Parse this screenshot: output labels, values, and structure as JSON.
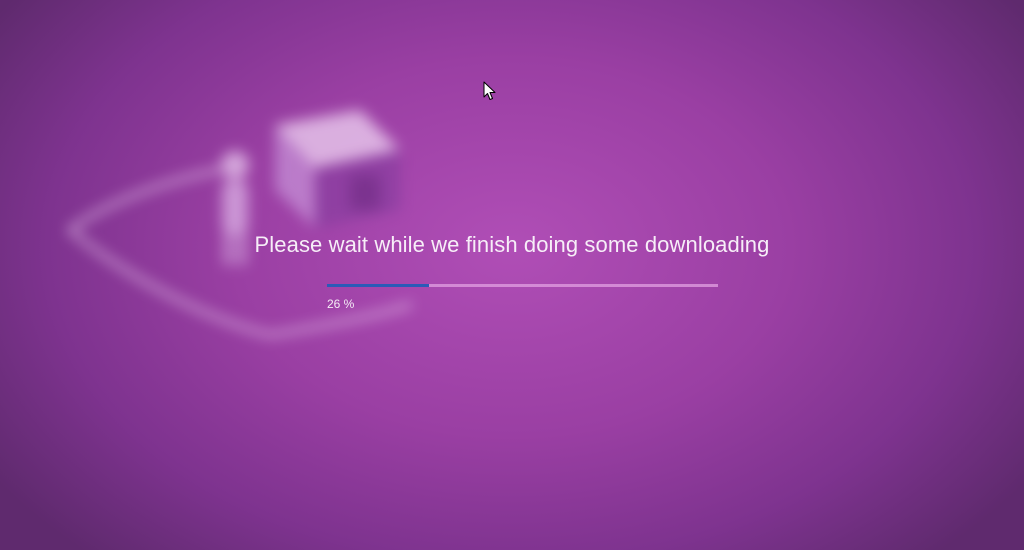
{
  "setup": {
    "message": "Please wait while we finish doing some downloading",
    "progress": {
      "value": 0.26,
      "label": "26 %"
    }
  },
  "colors": {
    "background": "#a645ad",
    "progress_fill": "#2a5bb8",
    "progress_track": "#e2a0e2",
    "text": "#f7eef8"
  },
  "icons": {
    "background_art": "house-and-person-illustration",
    "cursor": "mouse-pointer-icon"
  }
}
